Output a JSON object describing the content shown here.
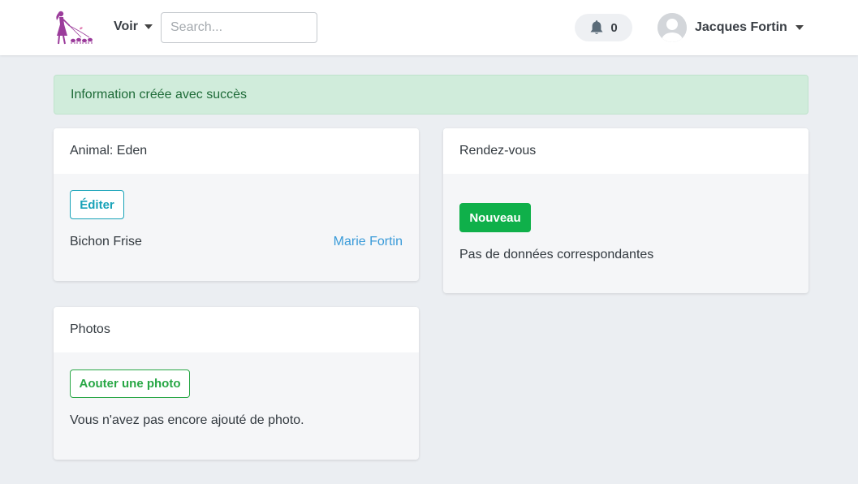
{
  "navbar": {
    "menu_label": "Voir",
    "search_placeholder": "Search...",
    "search_value": "",
    "notification_count": "0",
    "user_name": "Jacques Fortin"
  },
  "alert": {
    "message": "Information créée avec succès",
    "color": "#d0ecdb"
  },
  "animal_card": {
    "title": "Animal: Eden",
    "edit_label": "Éditer",
    "breed": "Bichon Frise",
    "owner": "Marie Fortin"
  },
  "appointments_card": {
    "title": "Rendez-vous",
    "new_label": "Nouveau",
    "empty_text": "Pas de données correspondantes"
  },
  "photos_card": {
    "title": "Photos",
    "add_label": "Aouter une photo",
    "empty_text": "Vous n'avez pas encore ajouté de photo."
  },
  "colors": {
    "success": "#0fb04a",
    "info": "#17a2b8",
    "link": "#3a9bd9",
    "logo": "#9b3c9b"
  },
  "icons": [
    "logo-icon",
    "caret-down-icon",
    "bell-icon",
    "avatar-icon"
  ]
}
